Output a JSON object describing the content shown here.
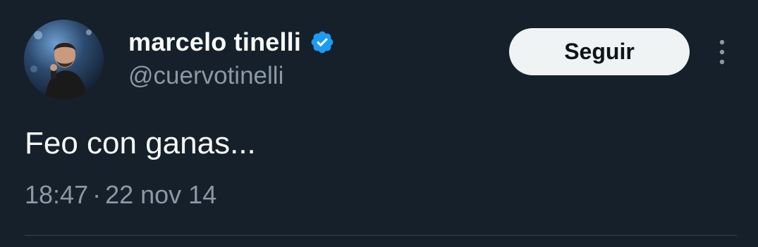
{
  "tweet": {
    "author": {
      "display_name": "marcelo tinelli",
      "handle": "@cuervotinelli",
      "verified": true,
      "avatar_icon": "profile-photo"
    },
    "follow_label": "Seguir",
    "more_icon": "more-vertical-icon",
    "text": "Feo con ganas...",
    "time": "18:47",
    "separator": "·",
    "date": "22 nov 14"
  },
  "colors": {
    "background": "#15202b",
    "primary_text": "#f7f9f9",
    "secondary_text": "#8b98a5",
    "verified_blue": "#1d9bf0",
    "button_bg": "#eff3f4",
    "divider": "#38444d"
  }
}
